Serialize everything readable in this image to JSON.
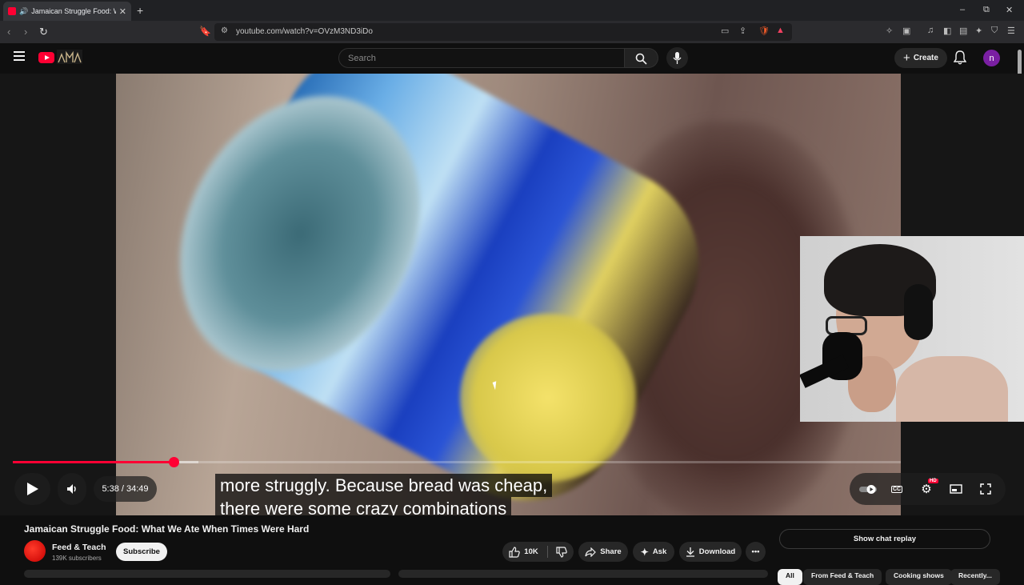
{
  "browser": {
    "tab_title": "Jamaican Struggle Food: What We Ate When Times Were Hard",
    "tab_close": "✕",
    "new_tab": "+",
    "url": "youtube.com/watch?v=OVzM3ND3iDo",
    "window_controls": [
      "–",
      "⧉",
      "✕"
    ]
  },
  "header": {
    "search_placeholder": "Search",
    "create_label": "Create",
    "avatar_letter": "n"
  },
  "player": {
    "caption_line1": "more struggly. Because bread was cheap,",
    "caption_line2": "there were some crazy combinations",
    "current_time": "5:38",
    "duration": "34:49",
    "time_display": "5:38 / 34:49",
    "played_fraction": 0.181,
    "buffered_fraction": 0.209,
    "hd_badge": "HD",
    "cc_label": "CC"
  },
  "video": {
    "title": "Jamaican Struggle Food: What We Ate When Times Were Hard",
    "channel_name": "Feed & Teach",
    "subscribers": "139K subscribers",
    "subscribe_label": "Subscribe",
    "likes": "10K",
    "share_label": "Share",
    "ask_label": "Ask",
    "download_label": "Download"
  },
  "sidebar": {
    "chat_replay_label": "Show chat replay",
    "chips": [
      "All",
      "From Feed & Teach",
      "Cooking shows",
      "Recently..."
    ]
  },
  "colors": {
    "accent": "#ff0033",
    "background": "#0f0f0f",
    "avatar": "#7a1fa2"
  }
}
